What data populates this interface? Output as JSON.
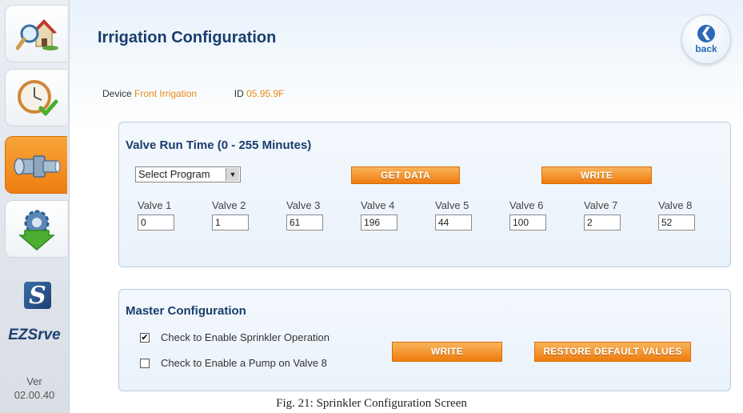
{
  "sidebar": {
    "items": [
      {
        "name": "home-search",
        "icon": "house-magnifier-icon"
      },
      {
        "name": "schedule",
        "icon": "clock-check-icon"
      },
      {
        "name": "irrigation",
        "icon": "sprinkler-valve-icon",
        "active": true
      },
      {
        "name": "download-settings",
        "icon": "gear-download-icon"
      }
    ],
    "logo_letter": "S",
    "brand": "EZSrve",
    "version_label": "Ver",
    "version": "02.00.40"
  },
  "header": {
    "title": "Irrigation Configuration",
    "back_label": "back"
  },
  "device": {
    "label": "Device",
    "name": "Front Irrigation",
    "id_label": "ID",
    "id": "05.95.9F"
  },
  "valve_panel": {
    "title": "Valve Run Time (0 - 255 Minutes)",
    "select_value": "Select Program",
    "get_data_label": "GET DATA",
    "write_label": "WRITE",
    "valves": [
      {
        "label": "Valve 1",
        "value": "0"
      },
      {
        "label": "Valve 2",
        "value": "1"
      },
      {
        "label": "Valve 3",
        "value": "61"
      },
      {
        "label": "Valve 4",
        "value": "196"
      },
      {
        "label": "Valve 5",
        "value": "44"
      },
      {
        "label": "Valve 6",
        "value": "100"
      },
      {
        "label": "Valve 7",
        "value": "2"
      },
      {
        "label": "Valve 8",
        "value": "52"
      }
    ]
  },
  "master_panel": {
    "title": "Master Configuration",
    "enable_sprinkler_label": "Check to Enable Sprinkler Operation",
    "enable_sprinkler_checked": true,
    "enable_pump_label": "Check to Enable a Pump  on Valve 8",
    "enable_pump_checked": false,
    "write_label": "WRITE",
    "restore_label": "RESTORE DEFAULT VALUES"
  },
  "caption": "Fig. 21: Sprinkler Configuration Screen",
  "colors": {
    "accent_orange": "#ef7c0e",
    "title_blue": "#1a3d6d",
    "value_orange": "#e88a1a"
  }
}
